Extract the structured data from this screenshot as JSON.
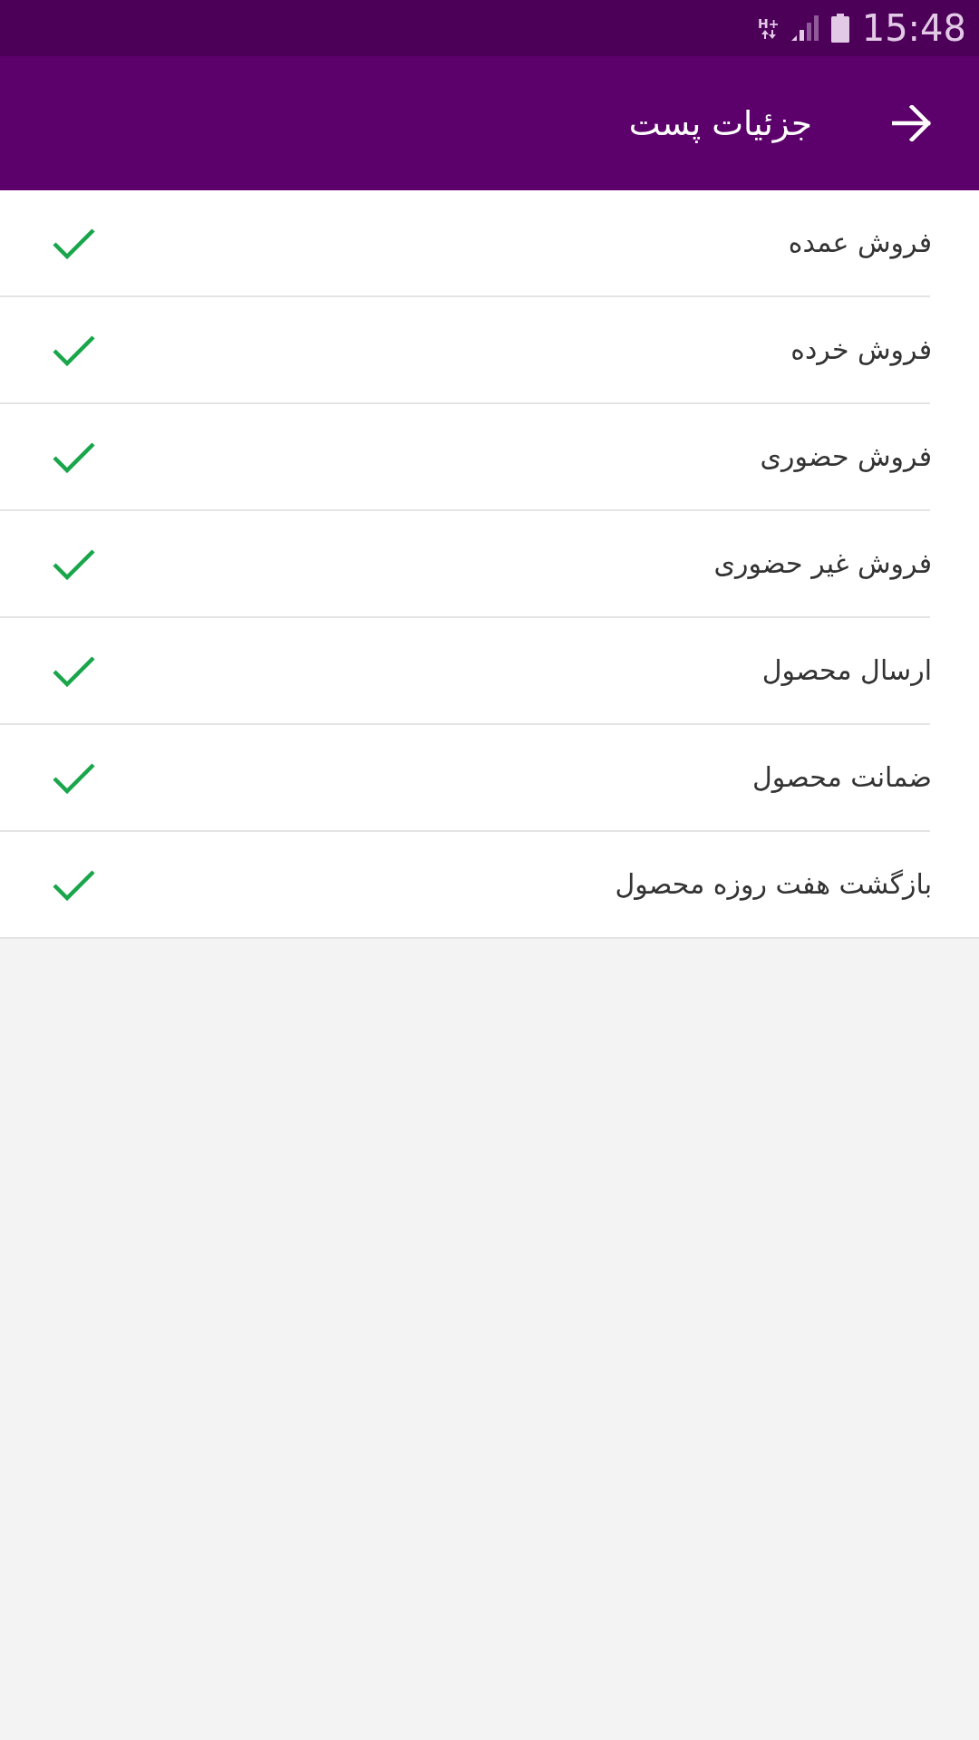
{
  "status_bar": {
    "network_type": "H+",
    "time": "15:48"
  },
  "app_bar": {
    "title": "جزئیات پست"
  },
  "items": [
    {
      "label": "فروش عمده",
      "checked": true
    },
    {
      "label": "فروش خرده",
      "checked": true
    },
    {
      "label": "فروش حضوری",
      "checked": true
    },
    {
      "label": "فروش غیر حضوری",
      "checked": true
    },
    {
      "label": "ارسال محصول",
      "checked": true
    },
    {
      "label": "ضمانت محصول",
      "checked": true
    },
    {
      "label": "بازگشت هفت روزه محصول",
      "checked": true
    }
  ]
}
